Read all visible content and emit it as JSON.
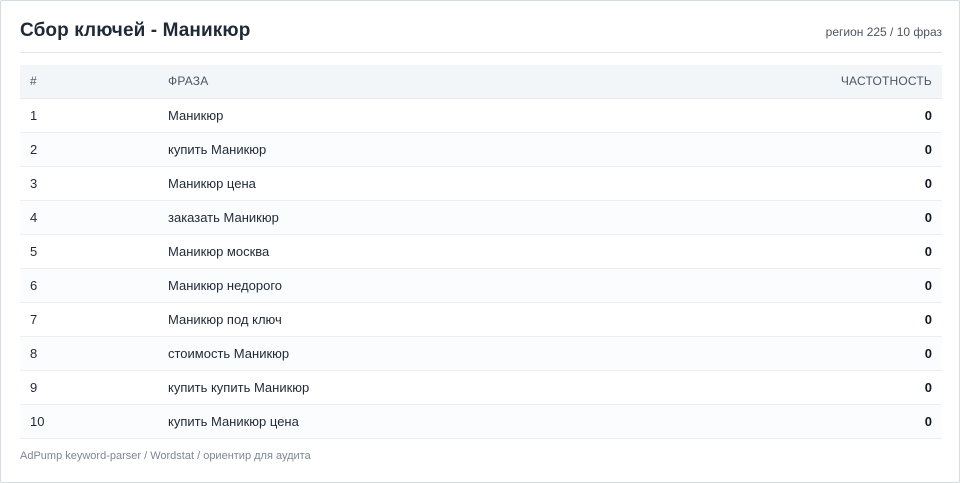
{
  "header": {
    "title": "Сбор ключей - Маникюр",
    "meta": "регион 225 / 10 фраз"
  },
  "table": {
    "columns": [
      "#",
      "ФРАЗА",
      "ЧАСТОТНОСТЬ"
    ],
    "rows": [
      {
        "num": "1",
        "phrase": "Маникюр",
        "freq": "0"
      },
      {
        "num": "2",
        "phrase": "купить Маникюр",
        "freq": "0"
      },
      {
        "num": "3",
        "phrase": "Маникюр цена",
        "freq": "0"
      },
      {
        "num": "4",
        "phrase": "заказать Маникюр",
        "freq": "0"
      },
      {
        "num": "5",
        "phrase": "Маникюр москва",
        "freq": "0"
      },
      {
        "num": "6",
        "phrase": "Маникюр недорого",
        "freq": "0"
      },
      {
        "num": "7",
        "phrase": "Маникюр под ключ",
        "freq": "0"
      },
      {
        "num": "8",
        "phrase": "стоимость Маникюр",
        "freq": "0"
      },
      {
        "num": "9",
        "phrase": "купить купить Маникюр",
        "freq": "0"
      },
      {
        "num": "10",
        "phrase": "купить Маникюр цена",
        "freq": "0"
      }
    ]
  },
  "footer": {
    "text": "AdPump keyword-parser / Wordstat / ориентир для аудита"
  }
}
